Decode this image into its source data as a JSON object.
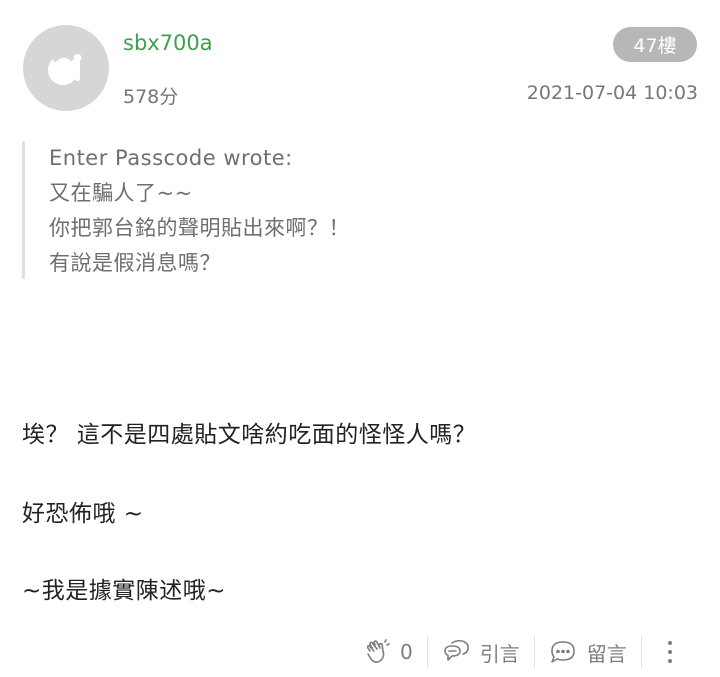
{
  "post": {
    "username": "sbx700a",
    "score": "578分",
    "floor": "47樓",
    "timestamp": "2021-07-04 10:03"
  },
  "quote": {
    "lines": [
      "Enter Passcode wrote:",
      "又在騙人了~~",
      "你把郭台銘的聲明貼出來啊？！",
      "有說是假消息嗎？"
    ]
  },
  "body": {
    "lines": [
      "埃？ 這不是四處貼文啥約吃面的怪怪人嗎？",
      "好恐佈哦 ~",
      "~我是據實陳述哦~"
    ]
  },
  "actions": {
    "like_count": "0",
    "quote_label": "引言",
    "comment_label": "留言"
  },
  "icons": {
    "avatar": "default-avatar-icon",
    "like": "clap-hands-icon",
    "quote": "quote-bubble-icon",
    "comment": "chat-bubble-icon",
    "more": "more-vertical-icon"
  }
}
